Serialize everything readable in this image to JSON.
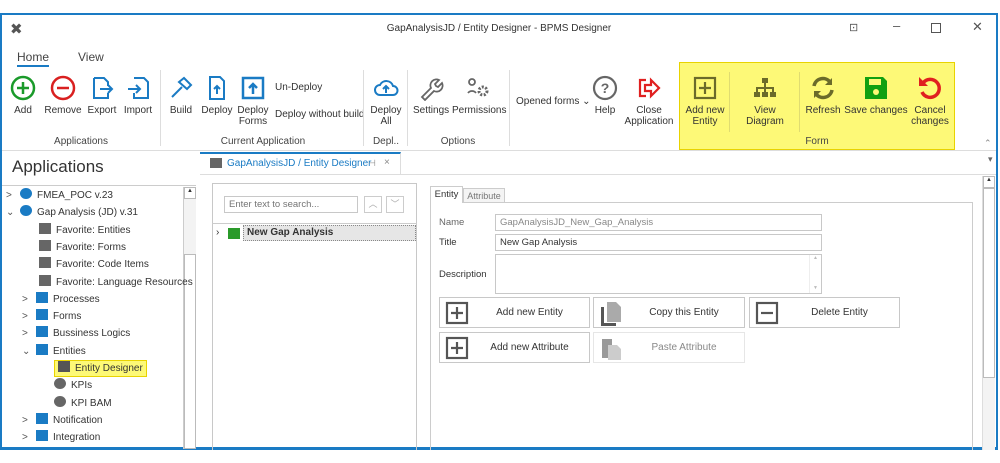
{
  "window": {
    "title": "GapAnalysisJD / Entity Designer - BPMS Designer"
  },
  "ribbon": {
    "tabs": [
      "Home",
      "View"
    ],
    "buttons": {
      "add": "Add",
      "remove": "Remove",
      "export": "Export",
      "import": "Import",
      "build": "Build",
      "deploy": "Deploy",
      "deploy_forms": "Deploy Forms",
      "undeploy": "Un-Deploy",
      "deploy_without_build": "Deploy without build",
      "deploy_all": "Deploy All",
      "settings": "Settings",
      "permissions": "Permissions",
      "opened_forms": "Opened forms",
      "help": "Help",
      "close_application": "Close Application",
      "add_new_entity": "Add new Entity",
      "view_diagram": "View Diagram",
      "refresh": "Refresh",
      "save_changes": "Save changes",
      "cancel_changes": "Cancel changes"
    },
    "groups": {
      "applications": "Applications",
      "current_application": "Current Application",
      "deploy": "Depl..",
      "options": "Options",
      "form": "Form"
    },
    "highlight_color": "#fdf977"
  },
  "sidebar": {
    "title": "Applications",
    "items": [
      {
        "label": "FMEA_POC v.23"
      },
      {
        "label": "Gap Analysis (JD) v.31"
      },
      {
        "label": "Favorite: Entities"
      },
      {
        "label": "Favorite: Forms"
      },
      {
        "label": "Favorite: Code Items"
      },
      {
        "label": "Favorite: Language Resources"
      },
      {
        "label": "Processes"
      },
      {
        "label": "Forms"
      },
      {
        "label": "Bussiness Logics"
      },
      {
        "label": "Entities"
      },
      {
        "label": "Entity Designer"
      },
      {
        "label": "KPIs"
      },
      {
        "label": "KPI BAM"
      },
      {
        "label": "Notification"
      },
      {
        "label": "Integration"
      }
    ]
  },
  "doc_tab": {
    "label": "GapAnalysisJD / Entity Designer"
  },
  "entity_tree": {
    "search_placeholder": "Enter text to search...",
    "root": "New Gap Analysis"
  },
  "editor": {
    "tabs": [
      "Entity",
      "Attribute"
    ],
    "name_label": "Name",
    "name_value": "GapAnalysisJD_New_Gap_Analysis",
    "title_label": "Title",
    "title_value": "New Gap Analysis",
    "description_label": "Description",
    "actions": {
      "add_entity": "Add new Entity",
      "copy_entity": "Copy this Entity",
      "delete_entity": "Delete Entity",
      "add_attribute": "Add new Attribute",
      "paste_attribute": "Paste Attribute"
    }
  }
}
